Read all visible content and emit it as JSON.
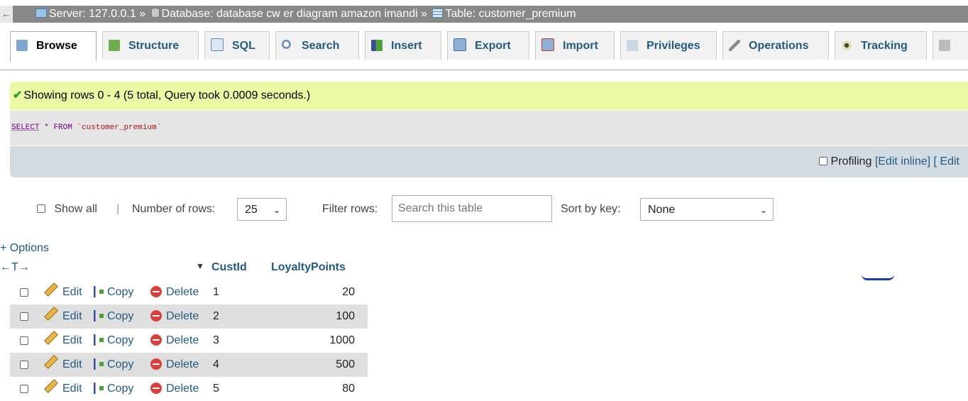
{
  "breadcrumb": {
    "back": "←",
    "server_label": "Server:",
    "server_value": "127.0.0.1",
    "sep": "»",
    "database_label": "Database:",
    "database_value": "database cw er diagram amazon imandi",
    "table_label": "Table:",
    "table_value": "customer_premium"
  },
  "tabs": [
    {
      "label": "Browse",
      "icon": "browse-icon"
    },
    {
      "label": "Structure",
      "icon": "structure-icon"
    },
    {
      "label": "SQL",
      "icon": "sql-icon"
    },
    {
      "label": "Search",
      "icon": "search-icon"
    },
    {
      "label": "Insert",
      "icon": "insert-icon"
    },
    {
      "label": "Export",
      "icon": "export-icon"
    },
    {
      "label": "Import",
      "icon": "import-icon"
    },
    {
      "label": "Privileges",
      "icon": "privileges-icon"
    },
    {
      "label": "Operations",
      "icon": "operations-icon"
    },
    {
      "label": "Tracking",
      "icon": "tracking-icon"
    }
  ],
  "message": {
    "text": "Showing rows 0 - 4 (5 total, Query took 0.0009 seconds.)"
  },
  "query": {
    "select": "SELECT",
    "star": "*",
    "from": "FROM",
    "table": "`customer_premium`"
  },
  "profiling": {
    "label": "Profiling",
    "edit_inline": "[Edit inline]",
    "edit": "[ Edit"
  },
  "nav": {
    "show_all": "Show all",
    "divider": "|",
    "rows_label": "Number of rows:",
    "rows_value": "25",
    "filter_label": "Filter rows:",
    "filter_placeholder": "Search this table",
    "sort_label": "Sort by key:",
    "sort_value": "None"
  },
  "table": {
    "options": "+ Options",
    "arrows": "←T→",
    "headers": [
      "CustId",
      "LoyaltyPoints"
    ],
    "action_labels": {
      "edit": "Edit",
      "copy": "Copy",
      "delete": "Delete"
    },
    "rows": [
      {
        "CustId": "1",
        "LoyaltyPoints": "20"
      },
      {
        "CustId": "2",
        "LoyaltyPoints": "100"
      },
      {
        "CustId": "3",
        "LoyaltyPoints": "1000"
      },
      {
        "CustId": "4",
        "LoyaltyPoints": "500"
      },
      {
        "CustId": "5",
        "LoyaltyPoints": "80"
      }
    ]
  },
  "colors": {
    "link": "#235a81",
    "success_bg": "#ebf8a4",
    "breadcrumb_bg": "#888888"
  }
}
